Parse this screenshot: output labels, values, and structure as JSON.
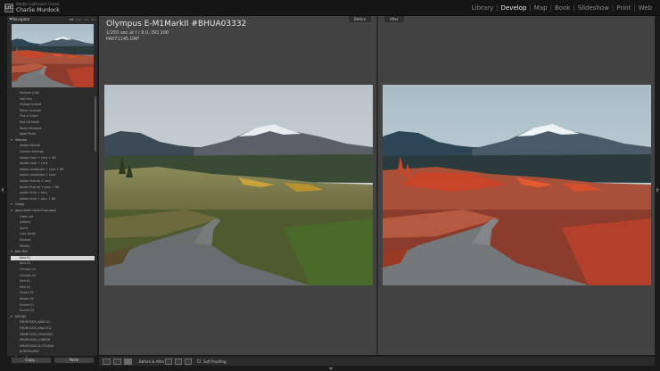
{
  "app": {
    "identity_sub": "Adobe Lightroom Classic",
    "identity_name": "Charlie Murdock",
    "logo_text": "LrC"
  },
  "modules": [
    {
      "label": "Library",
      "active": false
    },
    {
      "label": "Develop",
      "active": true
    },
    {
      "label": "Map",
      "active": false
    },
    {
      "label": "Book",
      "active": false
    },
    {
      "label": "Slideshow",
      "active": false
    },
    {
      "label": "Print",
      "active": false
    },
    {
      "label": "Web",
      "active": false
    }
  ],
  "navigator": {
    "label": "Navigator",
    "zoom_options": [
      "FIT",
      "FILL",
      "1:1",
      "3:1"
    ],
    "current_zoom": "FIT"
  },
  "presets": [
    {
      "label": "Polaroid 4-flat",
      "type": "item"
    },
    {
      "label": "Soft Mist",
      "type": "item"
    },
    {
      "label": "Vintage Instant",
      "type": "item"
    },
    {
      "label": "Warm Contrast",
      "type": "item"
    },
    {
      "label": "Pink & Green",
      "type": "item"
    },
    {
      "label": "Red Lift Matte",
      "type": "item"
    },
    {
      "label": "Warm Shadows",
      "type": "item"
    },
    {
      "label": "Aged Photo",
      "type": "item"
    },
    {
      "label": "Defaults",
      "type": "folder"
    },
    {
      "label": "Adobe Default",
      "type": "item"
    },
    {
      "label": "Camera Settings",
      "type": "item"
    },
    {
      "label": "Adobe Color + Lens + NR",
      "type": "item"
    },
    {
      "label": "Adobe Color + Lens",
      "type": "item"
    },
    {
      "label": "Adobe Landscape + Lens + NR",
      "type": "item"
    },
    {
      "label": "Adobe Landscape + Lens",
      "type": "item"
    },
    {
      "label": "Adobe Portrait + Lens",
      "type": "item"
    },
    {
      "label": "Adobe Portrait + Lens + NR",
      "type": "item"
    },
    {
      "label": "Adobe Vivid + Lens",
      "type": "item"
    },
    {
      "label": "Adobe Vivid + Lens + NR",
      "type": "item"
    },
    {
      "label": "Classy",
      "type": "folder"
    },
    {
      "label": "glory-mohn+blue+true-pack",
      "type": "folder"
    },
    {
      "label": "Cabin set",
      "type": "item"
    },
    {
      "label": "Indiana",
      "type": "item"
    },
    {
      "label": "Sorrel",
      "type": "item"
    },
    {
      "label": "Lucy shade",
      "type": "item"
    },
    {
      "label": "Shadow",
      "type": "item"
    },
    {
      "label": "Wreath",
      "type": "item"
    },
    {
      "label": "Kiev Red",
      "type": "folder"
    },
    {
      "label": "Aero 01",
      "type": "selected"
    },
    {
      "label": "Aero 02",
      "type": "item"
    },
    {
      "label": "Crimson 01",
      "type": "item"
    },
    {
      "label": "Crimson 02",
      "type": "item"
    },
    {
      "label": "Mint 01",
      "type": "item"
    },
    {
      "label": "Mint 02",
      "type": "item"
    },
    {
      "label": "Saloon 01",
      "type": "item"
    },
    {
      "label": "Saloon 02",
      "type": "item"
    },
    {
      "label": "Scarlet 01",
      "type": "item"
    },
    {
      "label": "Scarlet 02",
      "type": "item"
    },
    {
      "label": "MOODS",
      "type": "folder"
    },
    {
      "label": "MM/MOODS_ANALOG",
      "type": "item"
    },
    {
      "label": "MM/MOODS_ANALOG2",
      "type": "item"
    },
    {
      "label": "MM/MOODS_HOKKAIDO",
      "type": "item"
    },
    {
      "label": "MM/MOODS_LONDON",
      "type": "item"
    },
    {
      "label": "MM/MOODS_SCOTLAND",
      "type": "item"
    },
    {
      "label": "NORDISLAND",
      "type": "item"
    },
    {
      "label": "Desert Tones",
      "type": "folder"
    }
  ],
  "panel_buttons": {
    "copy": "Copy...",
    "paste": "Paste"
  },
  "view": {
    "before_label": "Before",
    "after_label": "After",
    "camera_title": "Olympus E-M1MarkII #BHUA03332",
    "exposure_line": "1/250 sec at f / 8.0, ISO 200",
    "filename_line": "PA071145.ORF"
  },
  "toolbar": {
    "before_after_label": "Before & After :",
    "soft_proofing_label": "Soft Proofing",
    "soft_proofing_checked": false
  }
}
